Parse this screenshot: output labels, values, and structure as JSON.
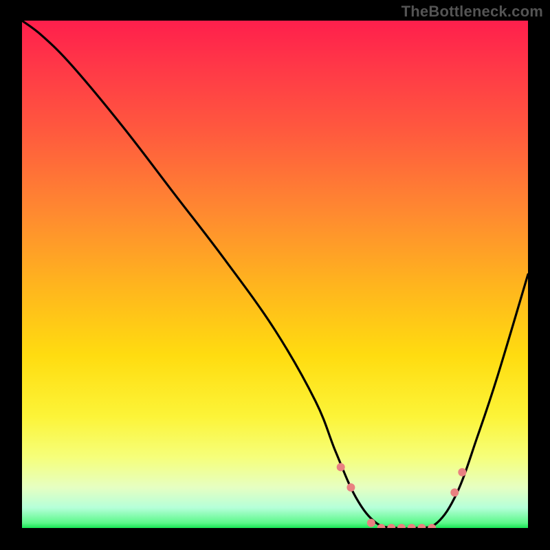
{
  "watermark": "TheBottleneck.com",
  "colors": {
    "background": "#000000",
    "curve_stroke": "#000000",
    "marker_fill": "#e98181",
    "watermark_text": "#545454",
    "gradient_top": "#ff1f4c",
    "gradient_bottom": "#18e454"
  },
  "chart_data": {
    "type": "line",
    "title": "",
    "xlabel": "",
    "ylabel": "",
    "xlim": [
      0,
      100
    ],
    "ylim": [
      0,
      100
    ],
    "grid": false,
    "legend": false,
    "x": [
      0,
      4,
      10,
      20,
      30,
      40,
      50,
      58,
      62,
      66,
      70,
      74,
      78,
      82,
      86,
      90,
      94,
      100
    ],
    "y": [
      100,
      97,
      91,
      79,
      66,
      53,
      39,
      25,
      15,
      6,
      1,
      0,
      0,
      1,
      7,
      18,
      30,
      50
    ],
    "annotations": [
      {
        "x": 63,
        "y": 12,
        "label": ""
      },
      {
        "x": 65,
        "y": 8,
        "label": ""
      },
      {
        "x": 69,
        "y": 1,
        "label": ""
      },
      {
        "x": 71,
        "y": 0,
        "label": ""
      },
      {
        "x": 73,
        "y": 0,
        "label": ""
      },
      {
        "x": 75,
        "y": 0,
        "label": ""
      },
      {
        "x": 77,
        "y": 0,
        "label": ""
      },
      {
        "x": 79,
        "y": 0,
        "label": ""
      },
      {
        "x": 81,
        "y": 0,
        "label": ""
      },
      {
        "x": 85.5,
        "y": 7,
        "label": ""
      },
      {
        "x": 87,
        "y": 11,
        "label": ""
      }
    ],
    "series": [
      {
        "name": "bottleneck-curve",
        "x": [
          0,
          4,
          10,
          20,
          30,
          40,
          50,
          58,
          62,
          66,
          70,
          74,
          78,
          82,
          86,
          90,
          94,
          100
        ],
        "y": [
          100,
          97,
          91,
          79,
          66,
          53,
          39,
          25,
          15,
          6,
          1,
          0,
          0,
          1,
          7,
          18,
          30,
          50
        ]
      }
    ]
  }
}
